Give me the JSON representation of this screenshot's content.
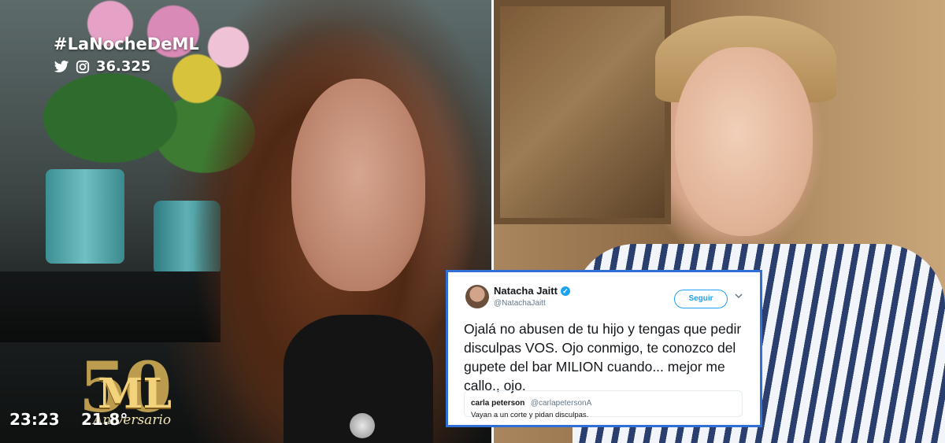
{
  "overlay": {
    "hashtag": "#LaNocheDeML",
    "stats_value": "36.325",
    "time": "23:23",
    "temperature": "21.8°",
    "logo_number": "50",
    "logo_text": "ML",
    "logo_subtext": "Aniversario"
  },
  "tweet": {
    "author_name": "Natacha Jaitt",
    "author_handle": "@NatachaJaitt",
    "follow_label": "Seguir",
    "text": "Ojalá no abusen de tu hijo y tengas que pedir disculpas VOS. Ojo conmigo, te conozco del gupete del bar MILION cuando... mejor me callo., ojo.",
    "quoted": {
      "author_name": "carla peterson",
      "author_handle": "@carlapetersonA",
      "text": "Vayan a un corte y pidan disculpas."
    }
  },
  "colors": {
    "tweet_border": "#2f6fd6",
    "twitter_blue": "#1da1f2"
  }
}
